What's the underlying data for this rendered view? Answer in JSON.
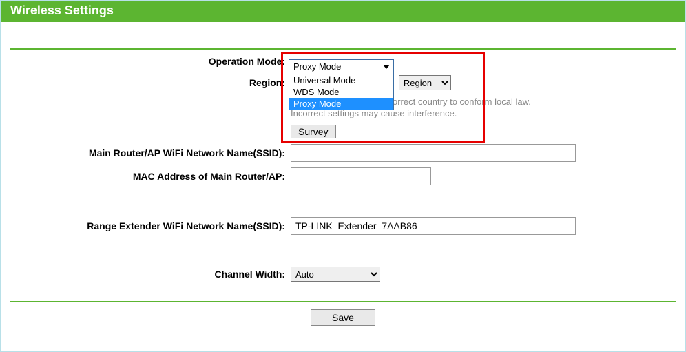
{
  "header": {
    "title": "Wireless Settings"
  },
  "form": {
    "operation_mode": {
      "label": "Operation Mode:",
      "selected": "Proxy Mode",
      "options": [
        "Universal Mode",
        "WDS Mode",
        "Proxy Mode"
      ]
    },
    "region": {
      "label": "Region:",
      "selected": "Region",
      "note_line1": "orrect country to conform local law.",
      "note_line2": "Incorrect settings may cause interference."
    },
    "survey": {
      "label": "Survey"
    },
    "main_ssid": {
      "label": "Main Router/AP WiFi Network Name(SSID):",
      "value": ""
    },
    "main_mac": {
      "label": "MAC Address of Main Router/AP:",
      "value": ""
    },
    "ext_ssid": {
      "label": "Range Extender WiFi Network Name(SSID):",
      "value": "TP-LINK_Extender_7AAB86"
    },
    "channel_width": {
      "label": "Channel Width:",
      "selected": "Auto"
    },
    "save": {
      "label": "Save"
    }
  }
}
